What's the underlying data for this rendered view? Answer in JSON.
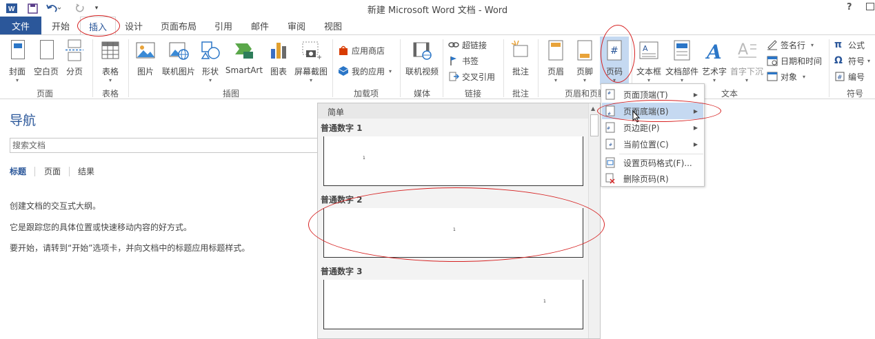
{
  "window": {
    "title": "新建 Microsoft Word 文档 - Word",
    "help": "?"
  },
  "quick_access": {
    "app_icon": "word-icon",
    "save_icon": "save-icon",
    "undo_icon": "undo-icon",
    "redo_icon": "redo-icon",
    "customize_icon": "customize-icon"
  },
  "tabs": {
    "file": "文件",
    "items": [
      "开始",
      "插入",
      "设计",
      "页面布局",
      "引用",
      "邮件",
      "审阅",
      "视图"
    ],
    "active": "插入"
  },
  "ribbon": {
    "buttons": {
      "cover": "封面",
      "blank_page": "空白页",
      "page_break": "分页",
      "table": "表格",
      "picture": "图片",
      "online_picture": "联机图片",
      "shapes": "形状",
      "smartart": "SmartArt",
      "chart": "图表",
      "screenshot": "屏幕截图",
      "app_store": "应用商店",
      "my_apps": "我的应用",
      "online_video": "联机视频",
      "hyperlink": "超链接",
      "bookmark": "书签",
      "cross_ref": "交叉引用",
      "comment": "批注",
      "header": "页眉",
      "footer": "页脚",
      "page_number": "页码",
      "textbox": "文本框",
      "quick_parts": "文档部件",
      "wordart": "艺术字",
      "drop_cap": "首字下沉",
      "signature": "签名行",
      "datetime": "日期和时间",
      "object": "对象",
      "equation": "公式",
      "symbol": "符号",
      "number": "编号"
    },
    "groups": {
      "pages": "页面",
      "tables": "表格",
      "illustrations": "插图",
      "addins": "加载项",
      "media": "媒体",
      "links": "链接",
      "comments": "批注",
      "header_footer": "页眉和页脚",
      "text": "文本",
      "symbols": "符号"
    }
  },
  "nav": {
    "title": "导航",
    "search_placeholder": "搜索文档",
    "tabs": [
      "标题",
      "页面",
      "结果"
    ],
    "lines": [
      "创建文档的交互式大纲。",
      "它是跟踪您的具体位置或快速移动内容的好方式。",
      "要开始，请转到“开始”选项卡，并向文档中的标题应用标题样式。"
    ]
  },
  "gallery": {
    "section": "简单",
    "items": [
      {
        "label": "普通数字 1",
        "num": "1"
      },
      {
        "label": "普通数字 2",
        "num": "1"
      },
      {
        "label": "普通数字 3",
        "num": "1"
      }
    ]
  },
  "menu": {
    "items": [
      {
        "label": "页面顶端(T)",
        "arrow": true
      },
      {
        "label": "页面底端(B)",
        "arrow": true
      },
      {
        "label": "页边距(P)",
        "arrow": true
      },
      {
        "label": "当前位置(C)",
        "arrow": true
      },
      {
        "label": "设置页码格式(F)...",
        "arrow": false
      },
      {
        "label": "删除页码(R)",
        "arrow": false
      }
    ],
    "highlighted_index": 1
  },
  "colors": {
    "accent": "#2b579a",
    "highlight": "#c5d9f1",
    "annotation": "#d62020"
  }
}
